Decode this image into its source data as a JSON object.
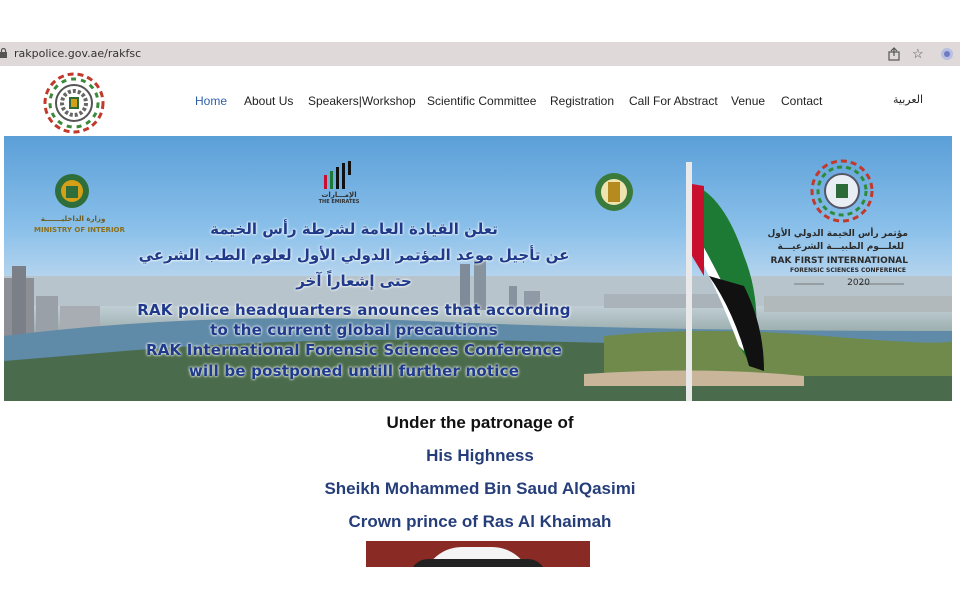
{
  "browser": {
    "url": "rakpolice.gov.ae/rakfsc",
    "icons": [
      "lock-icon",
      "share-icon",
      "star-icon",
      "extension-icon"
    ]
  },
  "nav": {
    "items": [
      {
        "label": "Home",
        "active": true
      },
      {
        "label": "About Us"
      },
      {
        "label": "Speakers|Workshop"
      },
      {
        "label": "Scientific Committee"
      },
      {
        "label": "Registration"
      },
      {
        "label": "Call For Abstract"
      },
      {
        "label": "Venue"
      },
      {
        "label": "Contact"
      }
    ],
    "language": "العربية"
  },
  "banner": {
    "ar_line1": "تعلن القيادة العامة لشرطة رأس الخيمة",
    "ar_line2": "عن تأجيل موعد المؤتمر الدولي الأول لعلوم الطب الشرعي",
    "ar_line3": "حتى إشعاراً آخر",
    "en_line1": "RAK police headquarters anounces that according",
    "en_line2": "to the current global precautions",
    "en_line3": "RAK International Forensic Sciences Conference",
    "en_line4": "will be postponed untill further notice",
    "moi_label_ar": "وزارة الداخليـــــــة",
    "moi_label_en": "MINISTRY OF INTERIOR",
    "emirates_label_ar": "الإمـــارات",
    "emirates_label_en": "THE EMIRATES",
    "conf_ar_1": "مؤتمر رأس الخيمة الدولي الأول",
    "conf_ar_2": "للعلـــوم الطبيـــة الشرعيـــة",
    "conf_en_1": "RAK FIRST INTERNATIONAL",
    "conf_en_2": "FORENSIC SCIENCES CONFERENCE",
    "conf_year": "2020"
  },
  "patronage": {
    "line1": "Under the patronage of",
    "line2": "His Highness",
    "line3": "Sheikh Mohammed Bin Saud AlQasimi",
    "line4": "Crown prince of Ras Al Khaimah"
  },
  "colors": {
    "nav_active": "#2e5fa8",
    "banner_text": "#1f3a8a",
    "patronage_blue": "#253e7a",
    "portrait_bg": "#8a2a24"
  }
}
